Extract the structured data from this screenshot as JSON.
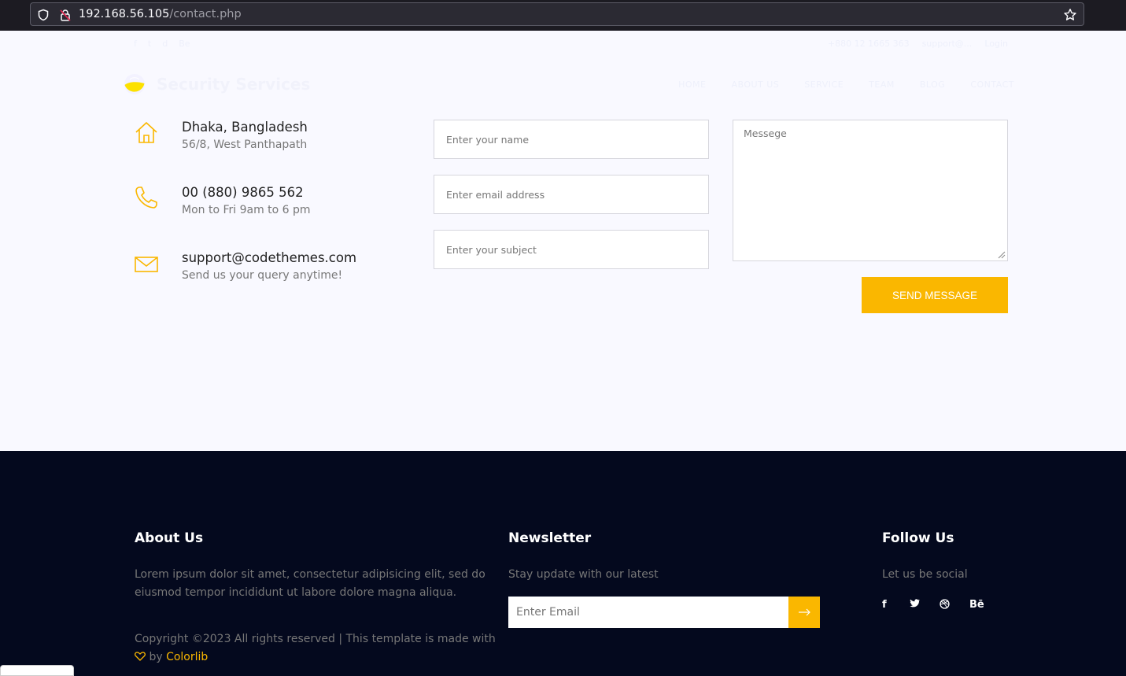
{
  "browser": {
    "url_host": "192.168.56.105",
    "url_path": "/contact.php"
  },
  "header": {
    "brand": "Security Services",
    "social_links": [
      "f",
      "t",
      "d",
      "Be"
    ],
    "top_contact": [
      "+880 12 1665 363",
      "support@...",
      "Login"
    ],
    "nav": [
      "HOME",
      "ABOUT US",
      "SERVICE",
      "TEAM",
      "BLOG",
      "CONTACT"
    ]
  },
  "contact_info": [
    {
      "title": "Dhaka, Bangladesh",
      "sub": "56/8, West Panthapath",
      "icon": "home-icon"
    },
    {
      "title": "00 (880) 9865 562",
      "sub": "Mon to Fri 9am to 6 pm",
      "icon": "phone-icon"
    },
    {
      "title": "support@codethemes.com",
      "sub": "Send us your query anytime!",
      "icon": "envelope-icon"
    }
  ],
  "form": {
    "name_placeholder": "Enter your name",
    "email_placeholder": "Enter email address",
    "subject_placeholder": "Enter your subject",
    "message_placeholder": "Messege",
    "send_label": "SEND MESSAGE"
  },
  "footer": {
    "about_title": "About Us",
    "about_text_1": "Lorem ipsum dolor sit amet, consectetur adipisicing elit, sed do",
    "about_text_2": "eiusmod tempor incididunt ut labore dolore magna aliqua.",
    "copyright_1": "Copyright ©2023 All rights reserved | This template is made with",
    "copyright_by": "by",
    "copyright_link": "Colorlib",
    "newsletter_title": "Newsletter",
    "newsletter_text": "Stay update with our latest",
    "newsletter_placeholder": "Enter Email",
    "follow_title": "Follow Us",
    "follow_text": "Let us be social",
    "social": [
      "f",
      "t",
      "dribbble",
      "Bē"
    ]
  },
  "colors": {
    "accent": "#fab700",
    "footer_bg": "#04091e",
    "page_bg": "#f9f9ff"
  }
}
